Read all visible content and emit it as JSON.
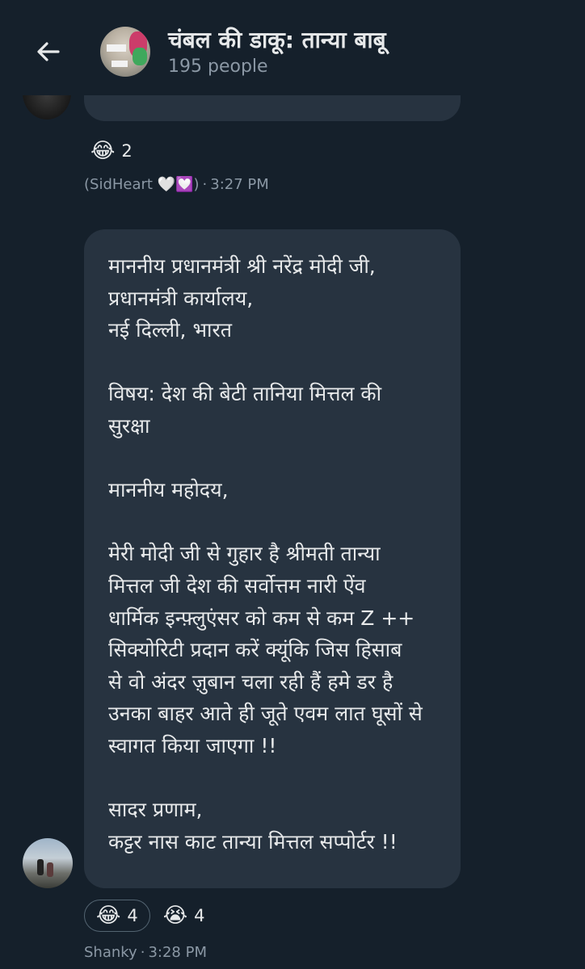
{
  "header": {
    "title": "चंबल की डाकू: तान्या बाबू",
    "subtitle": "195 people"
  },
  "prev_message": {
    "reactions": [
      {
        "emoji": "😂",
        "count": "2"
      }
    ],
    "sender": "(SidHeart 🤍💟)",
    "time": "3:27 PM"
  },
  "message": {
    "text": "माननीय प्रधानमंत्री श्री नरेंद्र मोदी जी,\nप्रधानमंत्री कार्यालय,\nनई दिल्ली, भारत\n\nविषय: देश की बेटी तानिया मित्तल की\nसुरक्षा\n\nमाननीय महोदय,\n\nमेरी मोदी जी से गुहार है श्रीमती तान्या\nमित्तल जी देश की सर्वोत्तम नारी ऐंव\nधार्मिक इन्फ़्लुएंसर को कम से कम Z ++\nसिक्योरिटी प्रदान करें क्यूंकि जिस हिसाब\nसे वो अंदर ज़ुबान चला रही हैं हमे डर है\nउनका बाहर आते ही जूते एवम लात घूसों से\nस्वागत किया जाएगा !!\n\nसादर प्रणाम,\nकट्टर नास काट तान्या मित्तल सप्पोर्टर !!",
    "reactions": [
      {
        "emoji": "😂",
        "count": "4"
      },
      {
        "emoji": "😭",
        "count": "4"
      }
    ],
    "sender": "Shanky",
    "time": "3:28 PM"
  },
  "icons": {
    "back": "arrow-left-icon"
  },
  "colors": {
    "background": "#15202b",
    "bubble": "#273340",
    "text": "#e7e9ea",
    "muted": "#8b98a5"
  }
}
